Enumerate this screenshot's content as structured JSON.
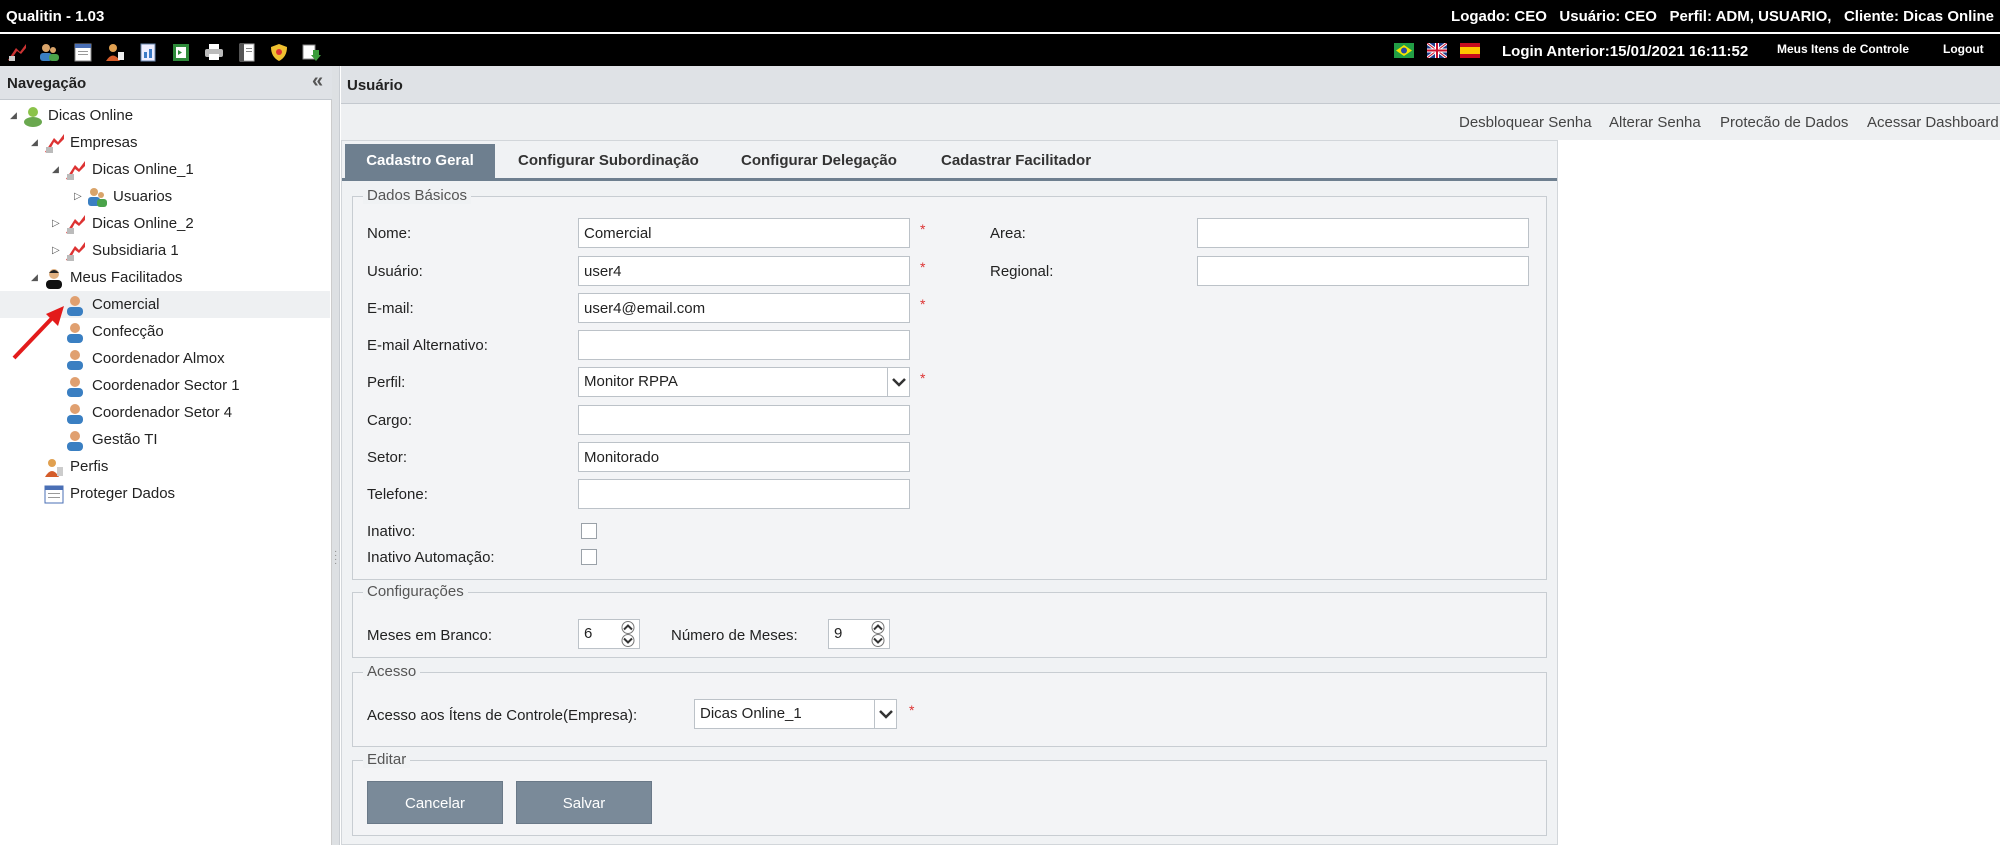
{
  "app": {
    "title": "Qualitin - 1.03"
  },
  "session": {
    "logado_label": "Logado:",
    "logado_value": "CEO",
    "usuario_label": "Usuário:",
    "usuario_value": "CEO",
    "perfil_label": "Perfil:",
    "perfil_value": "ADM, USUARIO,",
    "cliente_label": "Cliente:",
    "cliente_value": "Dicas Online",
    "login_anterior_label": "Login Anterior:",
    "login_anterior_value": "15/01/2021 16:11:52",
    "meus_itens": "Meus Itens de Controle",
    "logout": "Logout"
  },
  "toolbar": {
    "icons": [
      "companies-icon",
      "users-icon",
      "calendar-icon",
      "profiles-icon",
      "reports-icon",
      "export-icon",
      "print-icon",
      "manual-icon",
      "security-icon",
      "download-icon"
    ]
  },
  "flags": [
    "brazil-flag-icon",
    "uk-flag-icon",
    "spain-flag-icon"
  ],
  "nav": {
    "title": "Navegação",
    "collapse_icon": "«",
    "tree": [
      {
        "label": "Dicas Online"
      },
      {
        "label": "Empresas"
      },
      {
        "label": "Dicas Online_1"
      },
      {
        "label": "Usuarios"
      },
      {
        "label": "Dicas Online_2"
      },
      {
        "label": "Subsidiaria 1"
      },
      {
        "label": "Meus Facilitados"
      },
      {
        "label": "Comercial"
      },
      {
        "label": "Confecção"
      },
      {
        "label": "Coordenador Almox"
      },
      {
        "label": "Coordenador Sector 1"
      },
      {
        "label": "Coordenador Setor 4"
      },
      {
        "label": "Gestão TI"
      },
      {
        "label": "Perfis"
      },
      {
        "label": "Proteger Dados"
      }
    ]
  },
  "main": {
    "title": "Usuário",
    "actions": [
      "Desbloquear Senha",
      "Alterar Senha",
      "Protecão de Dados",
      "Acessar Dashboard"
    ],
    "tabs": [
      "Cadastro Geral",
      "Configurar Subordinação",
      "Configurar Delegação",
      "Cadastrar Facilitador"
    ]
  },
  "form": {
    "dados_basicos": {
      "legend": "Dados Básicos",
      "nome_label": "Nome:",
      "nome_value": "Comercial",
      "usuario_label": "Usuário:",
      "usuario_value": "user4",
      "email_label": "E-mail:",
      "email_value": "user4@email.com",
      "email_alt_label": "E-mail Alternativo:",
      "email_alt_value": "",
      "perfil_label": "Perfil:",
      "perfil_value": "Monitor RPPA",
      "cargo_label": "Cargo:",
      "cargo_value": "",
      "setor_label": "Setor:",
      "setor_value": "Monitorado",
      "telefone_label": "Telefone:",
      "telefone_value": "",
      "inativo_label": "Inativo:",
      "inativo_automacao_label": "Inativo Automação:",
      "area_label": "Area:",
      "area_value": "",
      "regional_label": "Regional:",
      "regional_value": "",
      "required_mark": "*"
    },
    "configuracoes": {
      "legend": "Configurações",
      "meses_branco_label": "Meses em Branco:",
      "meses_branco_value": "6",
      "numero_meses_label": "Número de Meses:",
      "numero_meses_value": "9"
    },
    "acesso": {
      "legend": "Acesso",
      "acesso_label": "Acesso aos Ítens de Controle(Empresa):",
      "acesso_value": "Dicas Online_1"
    },
    "editar": {
      "legend": "Editar",
      "cancel_label": "Cancelar",
      "save_label": "Salvar"
    }
  }
}
